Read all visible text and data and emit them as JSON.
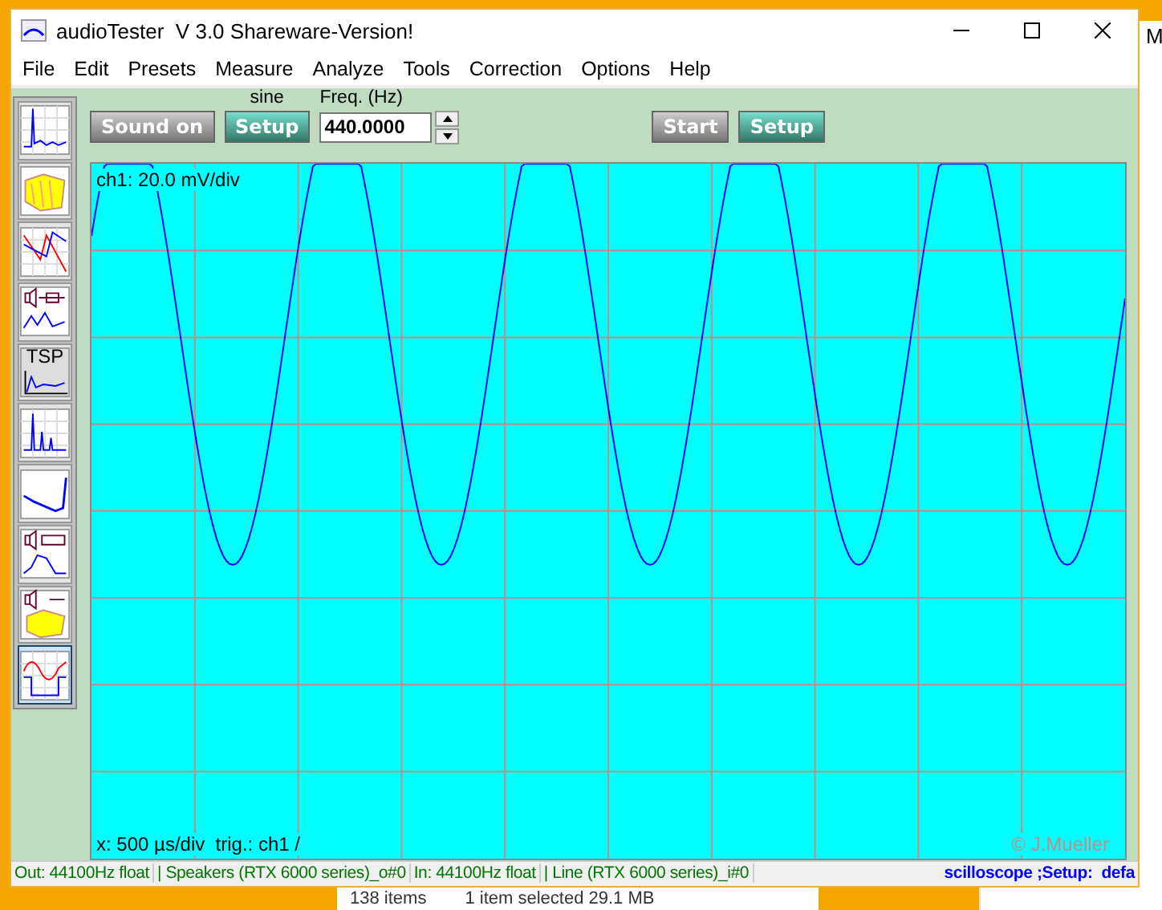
{
  "background": {
    "edge_letter": "M",
    "status_items": [
      "138 items",
      "1 item selected  29.1 MB"
    ]
  },
  "window": {
    "title": "audioTester  V 3.0 Shareware-Version!"
  },
  "menu": [
    "File",
    "Edit",
    "Presets",
    "Measure",
    "Analyze",
    "Tools",
    "Correction",
    "Options",
    "Help"
  ],
  "toolbar": {
    "sound_button": "Sound on",
    "signal_label": "sine",
    "setup_button": "Setup",
    "freq_label": "Freq. (Hz)",
    "freq_value": "440.0000",
    "start_button": "Start",
    "setup_button_2": "Setup"
  },
  "tools": [
    {
      "kind": "spectrum",
      "selected": false
    },
    {
      "kind": "waterfall",
      "selected": false
    },
    {
      "kind": "bode",
      "selected": false
    },
    {
      "kind": "speaker",
      "selected": false
    },
    {
      "kind": "tsp",
      "label": "TSP",
      "selected": false
    },
    {
      "kind": "harmonics",
      "selected": false
    },
    {
      "kind": "impedance",
      "selected": false
    },
    {
      "kind": "horn",
      "selected": false
    },
    {
      "kind": "speaker-waterfall",
      "selected": false
    },
    {
      "kind": "scope",
      "selected": true
    }
  ],
  "scope": {
    "channel_label": "ch1: 20.0 mV/div",
    "time_label": "x: 500 µs/div  trig.: ch1 /",
    "copyright": "© J.Mueller"
  },
  "status_bar": [
    "Out: 44100Hz float",
    "| Speakers (RTX 6000 series)_o#0",
    "In: 44100Hz float",
    "| Line (RTX 6000 series)_i#0",
    "scilloscope ;Setup:  defa"
  ]
}
